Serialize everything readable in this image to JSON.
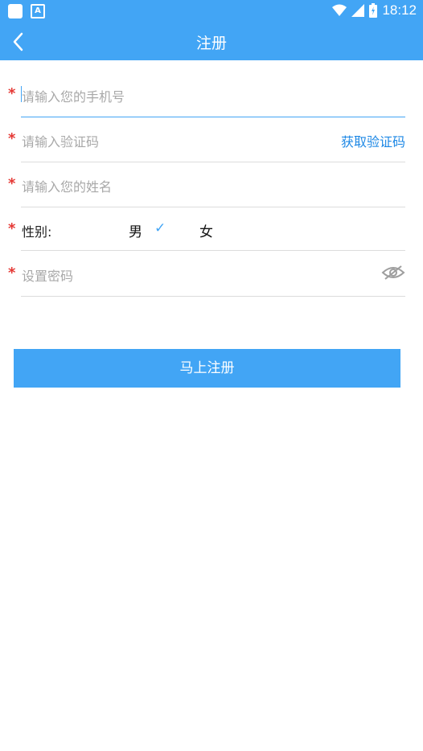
{
  "status_bar": {
    "time": "18:12",
    "notification_icon": "A"
  },
  "app_bar": {
    "title": "注册",
    "back_icon": "chevron-left-icon"
  },
  "form": {
    "phone_placeholder": "请输入您的手机号",
    "code_placeholder": "请输入验证码",
    "get_code_label": "获取验证码",
    "name_placeholder": "请输入您的姓名",
    "gender_label": "性别:",
    "gender_male": "男",
    "gender_female": "女",
    "selected_check": "✓",
    "password_placeholder": "设置密码",
    "required_mark": "*"
  },
  "submit_label": "马上注册",
  "colors": {
    "primary": "#42a5f5",
    "required": "#e53935",
    "link": "#1e88e5"
  }
}
